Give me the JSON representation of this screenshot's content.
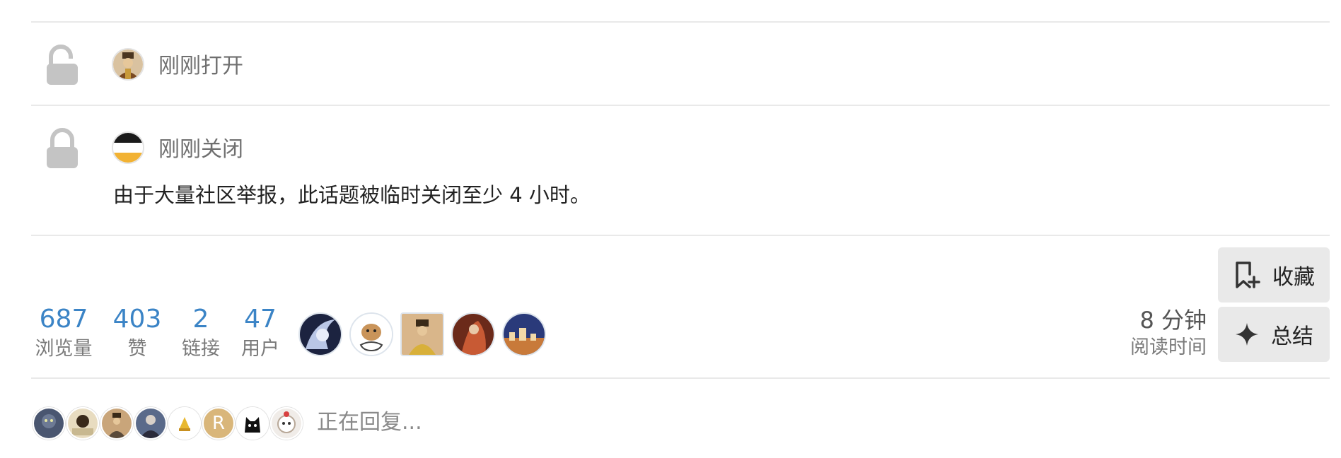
{
  "timeline": {
    "events": [
      {
        "label": "刚刚打开",
        "icon": "unlock-icon"
      },
      {
        "label": "刚刚关闭",
        "icon": "lock-icon"
      }
    ],
    "close_notice": "由于大量社区举报，此话题被临时关闭至少 4 小时。"
  },
  "stats": [
    {
      "value": "687",
      "label": "浏览量"
    },
    {
      "value": "403",
      "label": "赞"
    },
    {
      "value": "2",
      "label": "链接"
    },
    {
      "value": "47",
      "label": "用户"
    }
  ],
  "participants": [
    "participant-1",
    "participant-2",
    "participant-3",
    "participant-4",
    "participant-5"
  ],
  "reading_time": {
    "value": "8 分钟",
    "label": "阅读时间"
  },
  "actions": {
    "bookmark_label": "收藏",
    "summarize_label": "总结"
  },
  "replying": {
    "avatar_letter": "R",
    "text": "正在回复..."
  },
  "colors": {
    "stat_number": "#3b84c6",
    "button_bg": "#e9e9e9",
    "divider": "#e9e9e9"
  }
}
